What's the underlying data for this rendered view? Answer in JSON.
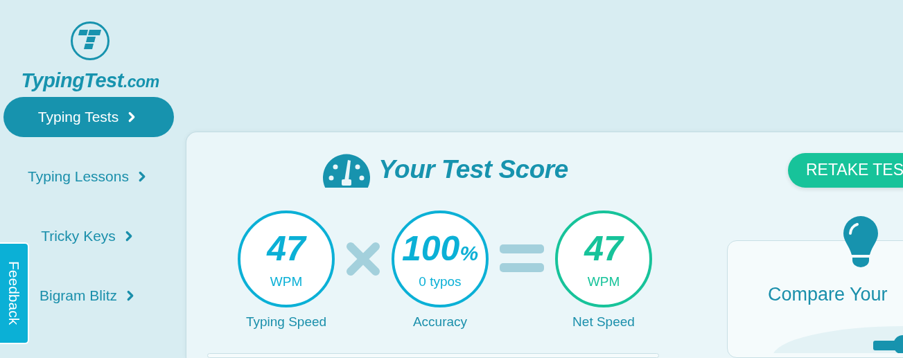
{
  "logo": {
    "name": "TypingTest",
    "suffix": ".com"
  },
  "nav": [
    {
      "label": "Typing Tests",
      "selected": true
    },
    {
      "label": "Typing Lessons",
      "selected": false
    },
    {
      "label": "Tricky Keys",
      "selected": false
    },
    {
      "label": "Bigram Blitz",
      "selected": false
    }
  ],
  "feedback_tab": {
    "label": "Feedback"
  },
  "score": {
    "title": "Your Test Score",
    "retake_button": "RETAKE TES",
    "stats": [
      {
        "value": "47",
        "sub": "WPM",
        "label": "Typing Speed",
        "color": "#0bb0d6"
      },
      {
        "value": "100",
        "unit": "%",
        "sub": "0 typos",
        "label": "Accuracy",
        "color": "#0bb0d6"
      },
      {
        "value": "47",
        "sub": "WPM",
        "label": "Net Speed",
        "color": "#17c39a"
      }
    ]
  },
  "compare": {
    "title": "Compare Your"
  }
}
